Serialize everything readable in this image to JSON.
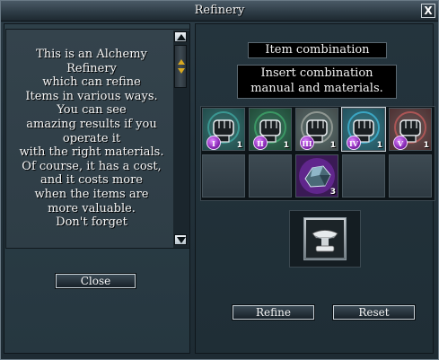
{
  "window": {
    "title": "Refinery"
  },
  "description": {
    "lines": [
      "This is an Alchemy",
      "Refinery",
      "which can refine",
      "Items in various ways.",
      "You can see",
      "amazing results if you",
      "operate it",
      "with the right materials.",
      "Of course, it has a cost,",
      "and it costs more",
      "when the items are",
      "more valuable.",
      "Don't forget"
    ]
  },
  "buttons": {
    "close": "Close",
    "refine": "Refine",
    "reset": "Reset"
  },
  "combination": {
    "heading": "Item combination",
    "instruction_line1": "Insert combination",
    "instruction_line2": "manual and materials."
  },
  "slots_row1": [
    {
      "badge": "I",
      "qty": "1",
      "icon": "manual-fist-icon",
      "color": "#3fa6a0"
    },
    {
      "badge": "II",
      "qty": "1",
      "icon": "manual-fist-icon",
      "color": "#3fa66a"
    },
    {
      "badge": "III",
      "qty": "1",
      "icon": "manual-fist-icon",
      "color": "#a0a6a0"
    },
    {
      "badge": "IV",
      "qty": "1",
      "icon": "manual-fist-icon",
      "color": "#3fb6d8"
    },
    {
      "badge": "V",
      "qty": "1",
      "icon": "manual-fist-icon",
      "color": "#c05a5a"
    }
  ],
  "slots_row2": [
    {
      "qty": "",
      "icon": ""
    },
    {
      "qty": "",
      "icon": ""
    },
    {
      "qty": "3",
      "icon": "crystal-ore-icon"
    },
    {
      "qty": "",
      "icon": ""
    },
    {
      "qty": "",
      "icon": ""
    }
  ],
  "result": {
    "icon": "anvil-icon"
  },
  "colors": {
    "accent_purple": "#9b3fd0",
    "button_border": "#c9d2d8"
  }
}
